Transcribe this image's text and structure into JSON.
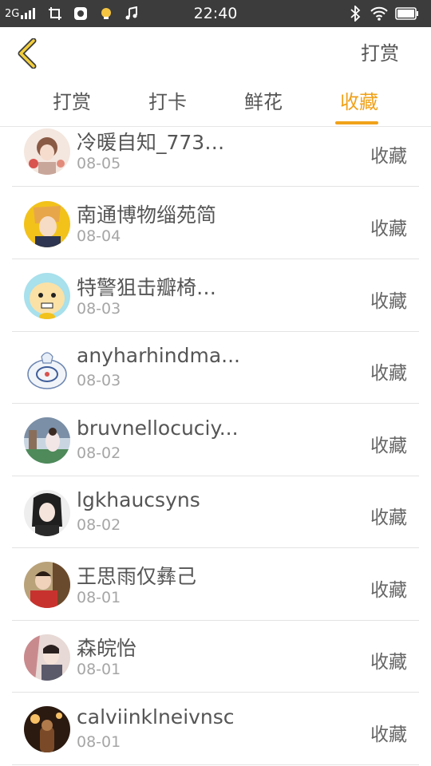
{
  "status_bar": {
    "network": "2G",
    "time": "22:40"
  },
  "header": {
    "action_label": "打赏"
  },
  "tabs": [
    {
      "label": "打赏",
      "active": false
    },
    {
      "label": "打卡",
      "active": false
    },
    {
      "label": "鲜花",
      "active": false
    },
    {
      "label": "收藏",
      "active": true
    }
  ],
  "list": [
    {
      "name": "冷暖自知_773…",
      "date": "08-05",
      "action": "收藏"
    },
    {
      "name": "南通博物缁苑简",
      "date": "08-04",
      "action": "收藏"
    },
    {
      "name": "特警狙击瓣椅…",
      "date": "08-03",
      "action": "收藏"
    },
    {
      "name": "anyharhindma...",
      "date": "08-03",
      "action": "收藏"
    },
    {
      "name": "bruvnellocuciy...",
      "date": "08-02",
      "action": "收藏"
    },
    {
      "name": "lgkhaucsyns",
      "date": "08-02",
      "action": "收藏"
    },
    {
      "name": "王思雨仅彝己",
      "date": "08-01",
      "action": "收藏"
    },
    {
      "name": "森皖怡",
      "date": "08-01",
      "action": "收藏"
    },
    {
      "name": "calviinklneivnsc",
      "date": "08-01",
      "action": "收藏"
    }
  ],
  "colors": {
    "accent": "#f0a21a",
    "status_bar": "#3c3c3c"
  }
}
